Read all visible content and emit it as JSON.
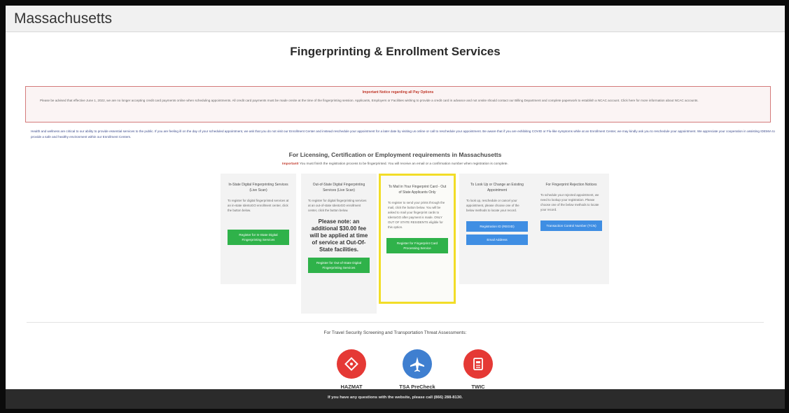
{
  "header": {
    "state": "Massachusetts"
  },
  "page": {
    "title": "Fingerprinting & Enrollment Services"
  },
  "notice": {
    "heading": "Important Notice regarding all Pay Options",
    "body": "Please be advised that effective June 1, 2022, we are no longer accepting credit card payments online when scheduling appointments. All credit card payments must be made onsite at the time of the fingerprinting session. Applicants, Employers or Facilities wishing to provide a credit card in advance and not onsite should contact our Billing Department and complete paperwork to establish a NCAC account. Click here for more information about NCAC accounts."
  },
  "health_notice": "Health and wellness are critical to our ability to provide essential services to the public. If you are feeling ill on the day of your scheduled appointment, we ask that you do not visit our Enrollment Center and instead reschedule your appointment for a later date by visiting us online or call to reschedule your appointment. Be aware that if you are exhibiting COVID or Flu-like symptoms while at an Enrollment Center, we may kindly ask you to reschedule your appointment. We appreciate your cooperation in assisting IDEMIA to provide a safe and healthy environment within our Enrollment Centers.",
  "licensing": {
    "heading": "For Licensing, Certification or Employment requirements in Massachusetts",
    "important_label": "Important!",
    "important_text": "You must finish the registration process to be fingerprinted. You will receive an email or a confirmation number when registration is complete."
  },
  "cards": [
    {
      "title": "In-State Digital Fingerprinting Services (Live Scan)",
      "description": "To register for digital fingerprinted services at an in-state IdentoGO enrollment center, click the button below.",
      "button": "Register for In-State Digital Fingerprinting Services"
    },
    {
      "title": "Out-of-State Digital Fingerprinting Services (Live Scan)",
      "description": "To register for digital fingerprinting services at an out-of-state IdentoGO enrollment center, click the button below.",
      "note": "Please note: an additional $30.00 fee will be applied at time of service at Out-Of-State facilities.",
      "button": "Register for Out-of-State Digital Fingerprinting Services"
    },
    {
      "title": "To Mail in Your Fingerprint Card - Out of State Applicants Only",
      "description": "To register to send your prints through the mail, click the button below. You will be asked to mail your fingerprint cards to IdentoGO after payment is made. ONLY OUT OF STATE RESIDENTS eligible for this option.",
      "button": "Register for Fingerprint Card Processing Service"
    },
    {
      "title": "To Look Up or Change an Existing Appointment",
      "description": "To look up, reschedule or cancel your appointment, please choose one of the below methods to locate your record.",
      "buttons": [
        "Registration ID (REGID)",
        "Email Address"
      ]
    },
    {
      "title": "For Fingerprint Rejection Notices",
      "description": "To schedule your rejected appointment, we need to lookup your registration. Please choose one of the below methods to locate your record.",
      "button": "Transaction Control Number (TCN)"
    }
  ],
  "travel": {
    "heading": "For Travel Security Screening and Transportation Threat Assessments:",
    "items": [
      {
        "label": "HAZMAT",
        "icon": "hazmat-icon",
        "color": "#e53935"
      },
      {
        "label": "TSA PreCheck",
        "icon": "airplane-icon",
        "color": "#3f7fd0"
      },
      {
        "label": "TWIC",
        "icon": "twic-card-icon",
        "color": "#e53935"
      }
    ]
  },
  "footer": {
    "text": "If you have any questions with the website, please call (866) 288-8130."
  },
  "colors": {
    "green": "#2fb24a",
    "blue": "#3f8ee3",
    "highlight": "#f2dd28",
    "notice_border": "#d47a7a"
  }
}
